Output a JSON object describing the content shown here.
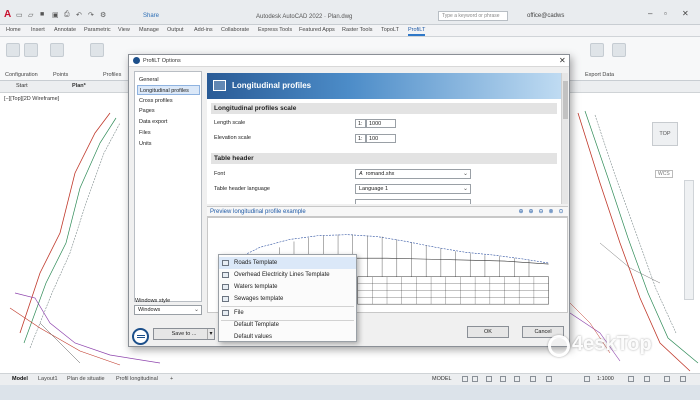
{
  "titlebar": {
    "app_title": "Autodesk AutoCAD 2022 · Plan.dwg",
    "share": "Share",
    "search_placeholder": "Type a keyword or phrase",
    "user": "office@cadws"
  },
  "ribbon": {
    "tabs": [
      "Home",
      "Insert",
      "Annotate",
      "Parametric",
      "View",
      "Manage",
      "Output",
      "Add-ins",
      "Collaborate",
      "Express Tools",
      "Featured Apps",
      "Raster Tools",
      "TopoLT",
      "ProfiLT"
    ],
    "active_tab": "ProfiLT",
    "panels": [
      "Configuration",
      "Points",
      "Profiles",
      "Export Data"
    ]
  },
  "file_tabs": [
    "Start",
    "Plan*"
  ],
  "viewport_label": "[−][Top][2D Wireframe]",
  "viewcube_label": "TOP",
  "wcs_label": "WCS",
  "dialog": {
    "title": "ProfiLT Options",
    "nav_items": [
      "General",
      "Longitudinal profiles",
      "Cross profiles",
      "Pages",
      "Data export",
      "Files",
      "Units"
    ],
    "selected_nav": "Longitudinal profiles",
    "windows_style_label": "Windows style",
    "windows_style_value": "Windows",
    "banner_title": "Longitudinal profiles",
    "sections": {
      "scale": {
        "title": "Longitudinal profiles scale",
        "length_label": "Length scale",
        "length_prefix": "1:",
        "length_value": "1000",
        "elevation_label": "Elevation scale",
        "elevation_prefix": "1:",
        "elevation_value": "100"
      },
      "table_header": {
        "title": "Table header",
        "font_label": "Font",
        "font_value": "romand.shx",
        "font_glyph": "A",
        "language_label": "Table header language",
        "language_value": "Language 1"
      }
    },
    "preview_title": "Preview longitudinal profile example",
    "zoom_icons": [
      "zoom-extents-icon",
      "zoom-in-icon",
      "zoom-out-icon",
      "zoom-window-icon",
      "zoom-previous-icon"
    ],
    "save_to_label": "Save to ...",
    "save_to_arrow": "▾",
    "ok_label": "OK",
    "cancel_label": "Cancel"
  },
  "save_menu": {
    "items": [
      "Roads Template",
      "Overhead Electricity Lines Template",
      "Waters template",
      "Sewages template",
      "File",
      "Default Template",
      "Default values"
    ],
    "highlighted": "Roads Template"
  },
  "layout_tabs": [
    "Model",
    "Layout1",
    "Plan de situatie",
    "Profil longitudinal",
    "+"
  ],
  "status": {
    "model": "MODEL",
    "scale": "1:1000"
  },
  "watermark": "4eskTop"
}
